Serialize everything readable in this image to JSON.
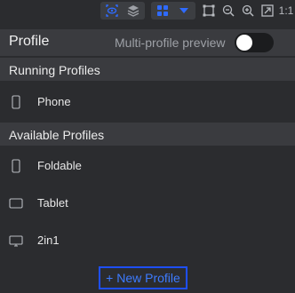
{
  "toolbar": {
    "icons": [
      "eye-frame-icon",
      "layers-icon",
      "grid-icon",
      "dropdown-icon",
      "crop-icon",
      "zoom-out-icon",
      "zoom-in-icon",
      "fit-screen-icon",
      "ratio-icon"
    ],
    "ratio_label": "1:1"
  },
  "header": {
    "title": "Profile",
    "toggle_label": "Multi-profile preview",
    "toggle_on": false
  },
  "running": {
    "heading": "Running Profiles",
    "items": [
      {
        "label": "Phone",
        "icon": "phone-icon"
      }
    ]
  },
  "available": {
    "heading": "Available Profiles",
    "items": [
      {
        "label": "Foldable",
        "icon": "foldable-icon"
      },
      {
        "label": "Tablet",
        "icon": "tablet-icon"
      },
      {
        "label": "2in1",
        "icon": "monitor-icon"
      }
    ]
  },
  "new_profile": {
    "label": "+ New Profile"
  },
  "colors": {
    "background": "#2b2c2f",
    "header": "#3a3b3f",
    "accent": "#1e4fff",
    "active_icon": "#2f6bff"
  }
}
